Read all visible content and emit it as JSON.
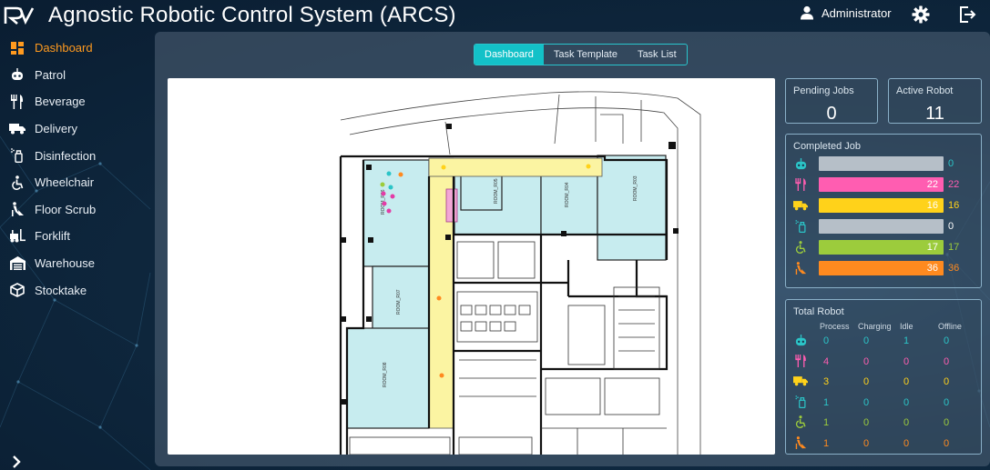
{
  "app": {
    "title": "Agnostic Robotic Control System (ARCS)",
    "user": "Administrator",
    "logo_text": "RV"
  },
  "colors": {
    "accent_orange": "#ff9a1f",
    "accent_cyan": "#13c1c8",
    "patrol": "#2bc4c7",
    "beverage": "#ff5db1",
    "delivery": "#ffd21a",
    "disinfection": "#ffffff",
    "wheelchair": "#9ccc3c",
    "floor_scrub": "#ff8a1f"
  },
  "sidebar": {
    "items": [
      {
        "label": "Dashboard",
        "icon": "dashboard-icon",
        "active": true
      },
      {
        "label": "Patrol",
        "icon": "robot-icon",
        "active": false
      },
      {
        "label": "Beverage",
        "icon": "utensils-icon",
        "active": false
      },
      {
        "label": "Delivery",
        "icon": "truck-icon",
        "active": false
      },
      {
        "label": "Disinfection",
        "icon": "spray-icon",
        "active": false
      },
      {
        "label": "Wheelchair",
        "icon": "wheelchair-icon",
        "active": false
      },
      {
        "label": "Floor Scrub",
        "icon": "floor-scrub-icon",
        "active": false
      },
      {
        "label": "Forklift",
        "icon": "forklift-icon",
        "active": false
      },
      {
        "label": "Warehouse",
        "icon": "warehouse-icon",
        "active": false
      },
      {
        "label": "Stocktake",
        "icon": "box-icon",
        "active": false
      }
    ]
  },
  "tabs": [
    {
      "label": "Dashboard",
      "active": true
    },
    {
      "label": "Task Template",
      "active": false
    },
    {
      "label": "Task List",
      "active": false
    }
  ],
  "stats": {
    "pending_jobs": {
      "label": "Pending Jobs",
      "value": "0"
    },
    "active_robot": {
      "label": "Active Robot",
      "value": "11"
    }
  },
  "completed_job": {
    "title": "Completed Job",
    "rows": [
      {
        "type": "patrol",
        "icon": "robot-icon",
        "value": 0,
        "bar_label": "",
        "total": "0",
        "bar_color": "#b6bfc8",
        "val_color": "#2bc4c7"
      },
      {
        "type": "beverage",
        "icon": "utensils-icon",
        "value": 22,
        "bar_label": "22",
        "total": "22",
        "bar_color": "#ff5db1",
        "val_color": "#ff5db1"
      },
      {
        "type": "delivery",
        "icon": "truck-icon",
        "value": 16,
        "bar_label": "16",
        "total": "16",
        "bar_color": "#ffd21a",
        "val_color": "#ffd21a"
      },
      {
        "type": "disinfection",
        "icon": "spray-icon",
        "value": 0,
        "bar_label": "",
        "total": "0",
        "bar_color": "#b6bfc8",
        "val_color": "#ffffff"
      },
      {
        "type": "wheelchair",
        "icon": "wheelchair-icon",
        "value": 17,
        "bar_label": "17",
        "total": "17",
        "bar_color": "#9ccc3c",
        "val_color": "#9ccc3c"
      },
      {
        "type": "floor_scrub",
        "icon": "floor-scrub-icon",
        "value": 36,
        "bar_label": "36",
        "total": "36",
        "bar_color": "#ff8a1f",
        "val_color": "#ff8a1f"
      }
    ]
  },
  "total_robot": {
    "title": "Total Robot",
    "columns": [
      "Process",
      "Charging",
      "Idle",
      "Offline"
    ],
    "rows": [
      {
        "type": "patrol",
        "icon": "robot-icon",
        "values": [
          "0",
          "0",
          "1",
          "0"
        ],
        "color": "#2bc4c7"
      },
      {
        "type": "beverage",
        "icon": "utensils-icon",
        "values": [
          "4",
          "0",
          "0",
          "0"
        ],
        "color": "#ff5db1"
      },
      {
        "type": "delivery",
        "icon": "truck-icon",
        "values": [
          "3",
          "0",
          "0",
          "0"
        ],
        "color": "#ffd21a"
      },
      {
        "type": "disinfection",
        "icon": "spray-icon",
        "values": [
          "1",
          "0",
          "0",
          "0"
        ],
        "color": "#2bc4c7"
      },
      {
        "type": "wheelchair",
        "icon": "wheelchair-icon",
        "values": [
          "1",
          "0",
          "0",
          "0"
        ],
        "color": "#9ccc3c"
      },
      {
        "type": "floor_scrub",
        "icon": "floor-scrub-icon",
        "values": [
          "1",
          "0",
          "0",
          "0"
        ],
        "color": "#ff8a1f"
      }
    ]
  },
  "floor_plan": {
    "room_labels": [
      "ROOM_R06",
      "ROOM_R05",
      "ROOM_R04",
      "ROOM_R03",
      "ROOM_R07",
      "ROOM_R08"
    ]
  }
}
